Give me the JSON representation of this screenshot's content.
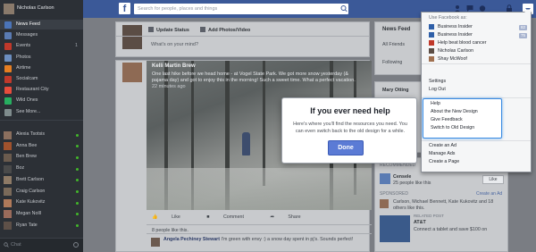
{
  "topbar": {
    "logo": "f",
    "search_placeholder": "Search for people, places and things"
  },
  "sidebar": {
    "user_name": "Nicholas Carlson",
    "items": [
      {
        "label": "News Feed",
        "color": "#4b74b8",
        "count": ""
      },
      {
        "label": "Messages",
        "color": "#5a7bb3",
        "count": ""
      },
      {
        "label": "Events",
        "color": "#c0392b",
        "count": "1"
      },
      {
        "label": "Photos",
        "color": "#6c8ebf",
        "count": ""
      },
      {
        "label": "Airtime",
        "color": "#e67e22",
        "count": ""
      },
      {
        "label": "Socialcam",
        "color": "#c0392b",
        "count": ""
      },
      {
        "label": "Restaurant City",
        "color": "#e74c3c",
        "count": ""
      },
      {
        "label": "Wild Ones",
        "color": "#27ae60",
        "count": ""
      },
      {
        "label": "See More...",
        "color": "#7f8c8d",
        "count": ""
      }
    ],
    "friends": [
      {
        "name": "Alexia Tsotsis",
        "color": "#8b6f5e"
      },
      {
        "name": "Anna Bee",
        "color": "#a0522d"
      },
      {
        "name": "Ben Brew",
        "color": "#6b5b4e"
      },
      {
        "name": "Boz",
        "color": "#4a4a4a"
      },
      {
        "name": "Brett Carlson",
        "color": "#8e7a66"
      },
      {
        "name": "Craig Carlson",
        "color": "#7a6a5a"
      },
      {
        "name": "Kate Kukovitz",
        "color": "#b07a5a"
      },
      {
        "name": "Megan Nolll",
        "color": "#9a6b5b"
      },
      {
        "name": "Ryan Tate",
        "color": "#5e5048"
      }
    ],
    "chat_label": "Chat"
  },
  "composer": {
    "update_status": "Update Status",
    "add_photo": "Add Photos/Video",
    "placeholder": "What's on your mind?"
  },
  "post": {
    "author": "Kelli Martin Brew",
    "caption": "One last hike before we head home - at Vogel State Park. We got more snow yesterday (& pajama day) and got to enjoy this in the morning! Such a sweet time. ",
    "caption_tail": "What a perfect vacation.",
    "timestamp": "22 minutes ago",
    "actions": [
      "Like",
      "Comment",
      "Share"
    ],
    "likes": "8 people like this.",
    "comment_author": "Angela Pechiney Stewart",
    "comment_text": "I'm green with envy :) a snow day spent in pj's. Sounds perfect!"
  },
  "right_column": {
    "news_feed": "News Feed",
    "all_friends": "All Friends",
    "following": "Following",
    "mary": "Mary Otting",
    "recommended": "RECOMMENDED",
    "page_name": "Censele",
    "page_likes": "25 people like this",
    "like_btn": "Like",
    "sponsored": "SPONSORED",
    "create_ad": "Create an Ad",
    "ad_text": "Carlson, Michael Bennett, Kate Kukovitz and 18 others like this.",
    "related": "RELATED POST",
    "att": "AT&T",
    "att_text": "Connect a tablet and save $100 on"
  },
  "help_dialog": {
    "title": "If you ever need help",
    "body": "Here's where you'll find the resources you need. You can even switch back to the old design for a while.",
    "done": "Done"
  },
  "menu": {
    "use_as": "Use Facebook as:",
    "pages": [
      {
        "label": "Business Insider",
        "badge": "82",
        "color": "#2e5fa8"
      },
      {
        "label": "Business Insider",
        "badge": "75",
        "color": "#2e5fa8"
      },
      {
        "label": "Help beat blood cancer",
        "badge": "",
        "color": "#c0392b"
      },
      {
        "label": "Nicholas Carlson",
        "badge": "",
        "color": "#5b4d45"
      },
      {
        "label": "Shay McWoof",
        "badge": "",
        "color": "#a07050"
      }
    ],
    "settings": "Settings",
    "logout": "Log Out",
    "help_items": [
      "Help",
      "About the New Design",
      "Give Feedback",
      "Switch to Old Design"
    ],
    "ad_items": [
      "Create an Ad",
      "Manage Ads",
      "Create a Page"
    ]
  }
}
